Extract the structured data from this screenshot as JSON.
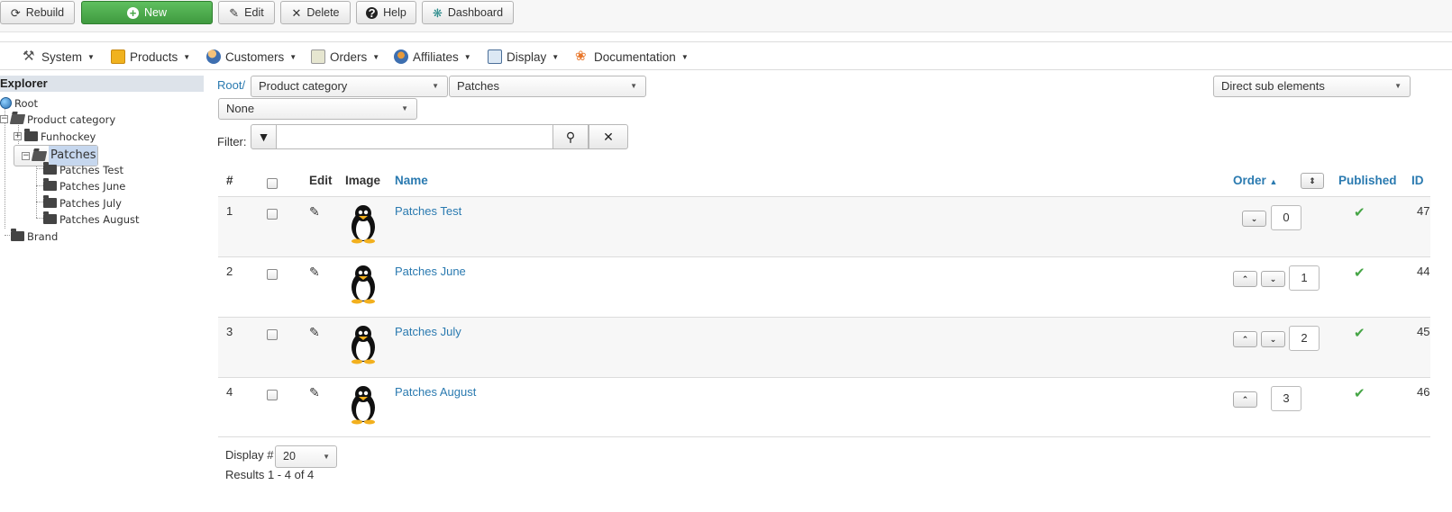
{
  "toolbar": {
    "rebuild": "Rebuild",
    "new": "New",
    "edit": "Edit",
    "delete": "Delete",
    "help": "Help",
    "dashboard": "Dashboard"
  },
  "menu": [
    "System",
    "Products",
    "Customers",
    "Orders",
    "Affiliates",
    "Display",
    "Documentation"
  ],
  "explorer": {
    "title": "Explorer",
    "nodes": [
      "Root",
      "Product category",
      "Funhockey",
      "Patches",
      "Patches Test",
      "Patches June",
      "Patches July",
      "Patches August",
      "Brand"
    ],
    "selected": "Patches"
  },
  "filters": {
    "root_link": "Root/",
    "category_select": "Product category",
    "sub_select": "Patches",
    "none_select": "None",
    "scope_select": "Direct sub elements",
    "filter_label": "Filter:",
    "filter_value": ""
  },
  "table": {
    "headers": {
      "num": "#",
      "edit": "Edit",
      "image": "Image",
      "name": "Name",
      "order": "Order",
      "published": "Published",
      "id": "ID"
    },
    "rows": [
      {
        "num": "1",
        "name": "Patches Test",
        "order": "0",
        "id": "47",
        "published": true
      },
      {
        "num": "2",
        "name": "Patches June",
        "order": "1",
        "id": "44",
        "published": true
      },
      {
        "num": "3",
        "name": "Patches July",
        "order": "2",
        "id": "45",
        "published": true
      },
      {
        "num": "4",
        "name": "Patches August",
        "order": "3",
        "id": "46",
        "published": true
      }
    ]
  },
  "footer": {
    "display_label": "Display #",
    "display_value": "20",
    "results": "Results 1 - 4 of 4"
  },
  "colors": {
    "link": "#2a7ab0",
    "new_button": "#46a546",
    "published_check": "#46a546",
    "explorer_header": "#dde3ea",
    "tree_selection": "#c6d7ee"
  }
}
